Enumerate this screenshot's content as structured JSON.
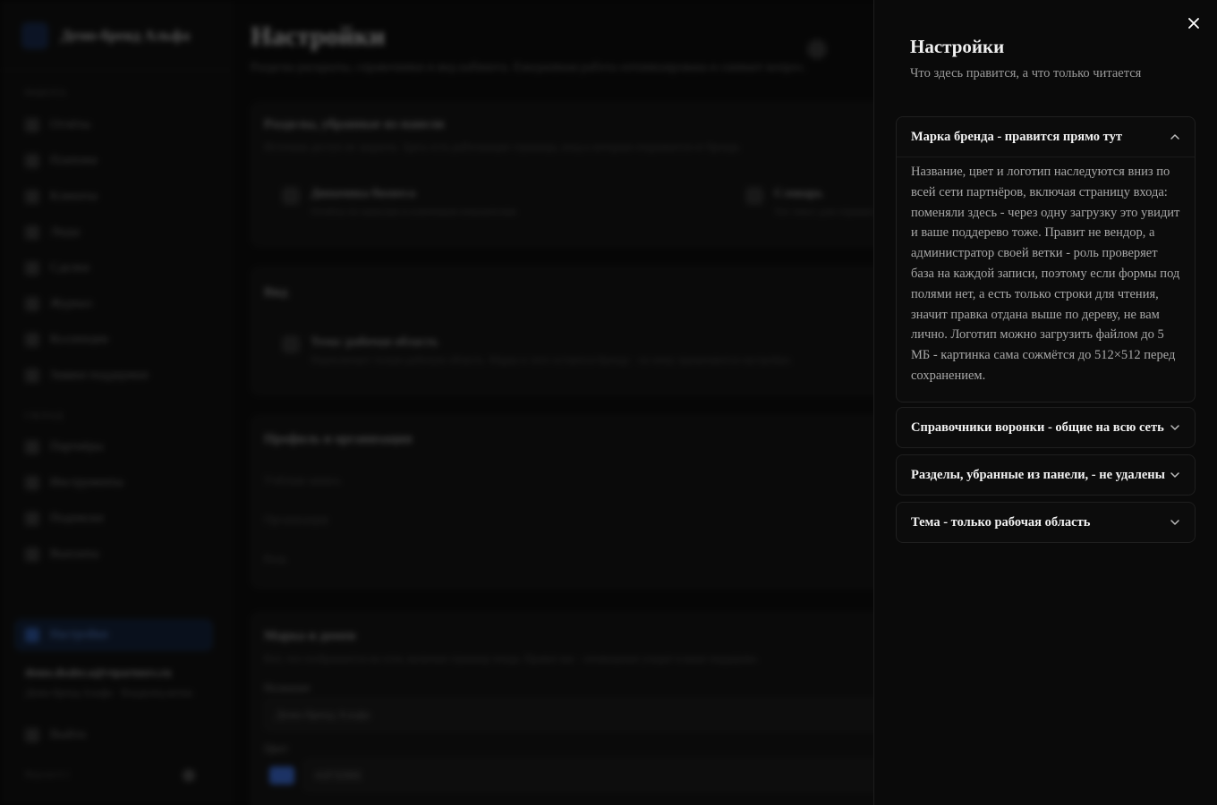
{
  "background": {
    "brand_name": "Демо-бренд Альфа",
    "nav_group_1": "РАБОТА",
    "nav_items_1": [
      "Отчёты",
      "Платежи",
      "Клиенты",
      "Лиды",
      "Сделки",
      "Журнал",
      "Коллекции",
      "Заявки поддержки"
    ],
    "nav_group_2": "СКЛАД",
    "nav_items_2": [
      "Партнёры",
      "Инструменты",
      "Подписки",
      "Выплаты"
    ],
    "active_item": "Настройки",
    "user_email": "demo.dealer.a@vtpartners.ru",
    "user_org": "Демо-бренд Альфа · Владелец ветки",
    "logout": "Выйти",
    "version": "Версия 0.1",
    "page_title": "Настройки",
    "page_subtitle": "Разделы раскрыты, справочники и вид кабинета. Ежедневная работа оптимизирована и снимает вопрос.",
    "card1_title": "Разделы, убранные из панели",
    "card1_sub": "Источник доступ не закрыты. Здесь есть работающие страницы, вход к которым открывается от бренда.",
    "card1_tile1_title": "Динамика бизнеса",
    "card1_tile1_sub": "Отчёты по каналам и ключевым показателям",
    "card1_tile2_title": "Словарь",
    "card1_tile2_sub": "Тот текст для справки",
    "card2_title": "Вид",
    "card2_tile_title": "Тема: рабочая область",
    "card2_tile_sub": "Переключает только рабочую область. Марка и лого остаются бренду - по нему применяются настройки.",
    "card3_title": "Профиль и организация",
    "card3_rows": [
      "Учётная запись",
      "Организация",
      "Роль"
    ],
    "card4_title": "Марка и домен",
    "card4_sub": "Всё, что отображается на сети, включая страницу входа. Правит вас - оповещение уходит в ваше поддерево.",
    "card4_name_label": "Название",
    "card4_name_value": "Демо-бренд Альфа",
    "card4_color_label": "Цвет",
    "card4_color_value": "#2F5DBE"
  },
  "drawer": {
    "title": "Настройки",
    "subtitle": "Что здесь правится, а что только читается",
    "close_label": "Закрыть",
    "sections": [
      {
        "label": "Марка бренда - правится прямо тут",
        "expanded": true,
        "body": "Название, цвет и логотип наследуются вниз по всей сети партнёров, включая страницу входа: поменяли здесь - через одну загрузку это увидит и ваше поддерево тоже. Правит не вендор, а администратор своей ветки - роль проверяет база на каждой записи, поэтому если формы под полями нет, а есть только строки для чтения, значит правка отдана выше по дереву, не вам лично. Логотип можно загрузить файлом до 5 МБ - картинка сама сожмётся до 512×512 перед сохранением."
      },
      {
        "label": "Справочники воронки - общие на всю сеть",
        "expanded": false
      },
      {
        "label": "Разделы, убранные из панели, - не удалены",
        "expanded": false
      },
      {
        "label": "Тема - только рабочая область",
        "expanded": false
      }
    ]
  },
  "icons": {
    "close": "close-icon",
    "chevron_up": "chevron-up-icon",
    "chevron_down": "chevron-down-icon"
  },
  "colors": {
    "drawer_bg": "#0a0a0a",
    "text_primary": "#f2f2f2",
    "text_secondary": "#a8a8a8",
    "accent": "#2f5dbe"
  }
}
